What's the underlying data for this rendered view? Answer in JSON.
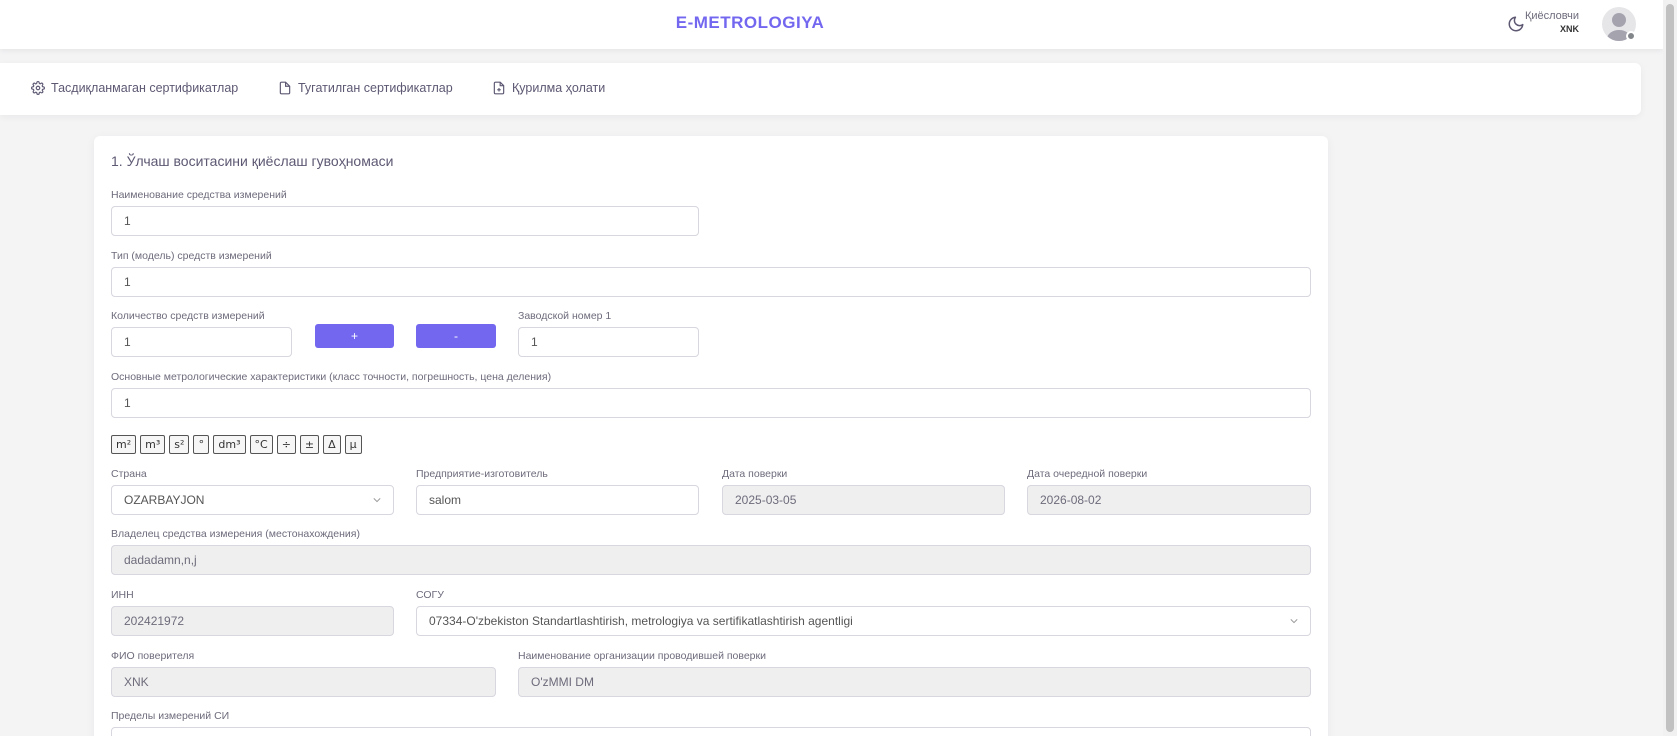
{
  "header": {
    "brand": "E-METROLOGIYA",
    "user_role": "Қиёсловчи",
    "user_name": "XNK"
  },
  "nav": [
    {
      "label": "Тасдиқланмаган сертификатлар",
      "icon": "gear-icon"
    },
    {
      "label": "Тугатилган сертификатлар",
      "icon": "file-icon"
    },
    {
      "label": "Қурилма ҳолати",
      "icon": "file-plus-icon"
    }
  ],
  "form": {
    "title": "1. Ўлчаш воситасини қиёслаш гувоҳномаси",
    "name": {
      "label": "Наименование средства измерений",
      "value": "1"
    },
    "type": {
      "label": "Тип (модель) средств измерений",
      "value": "1"
    },
    "qty": {
      "label": "Количество средств измерений",
      "value": "1"
    },
    "plus_label": "+",
    "minus_label": "-",
    "serial": {
      "label": "Заводской номер 1",
      "value": "1"
    },
    "characteristics": {
      "label": "Основные метрологические характеристики (класс точности, погрешность, цена деления)",
      "value": "1"
    },
    "symbols": [
      "m²",
      "m³",
      "s²",
      "°",
      "dm³",
      "°C",
      "÷",
      "±",
      "Δ",
      "μ"
    ],
    "country": {
      "label": "Страна",
      "value": "OZARBAYJON"
    },
    "manufacturer": {
      "label": "Предприятие-изготовитель",
      "value": "salom"
    },
    "verify_date": {
      "label": "Дата поверки",
      "value": "2025-03-05"
    },
    "next_date": {
      "label": "Дата очередной поверки",
      "value": "2026-08-02"
    },
    "owner": {
      "label": "Владелец средства измерения (местонахождения)",
      "value": "dadadamn,n,j"
    },
    "inn": {
      "label": "ИНН",
      "value": "202421972"
    },
    "sogu": {
      "label": "СОГУ",
      "value": "07334-O'zbekiston Standartlashtirish, metrologiya va sertifikatlashtirish agentligi"
    },
    "verifier": {
      "label": "ФИО поверителя",
      "value": "XNK"
    },
    "org": {
      "label": "Наименование организации проводившей поверки",
      "value": "O'zMMI DM"
    },
    "limits": {
      "label": "Пределы измерений СИ",
      "value": ""
    }
  }
}
